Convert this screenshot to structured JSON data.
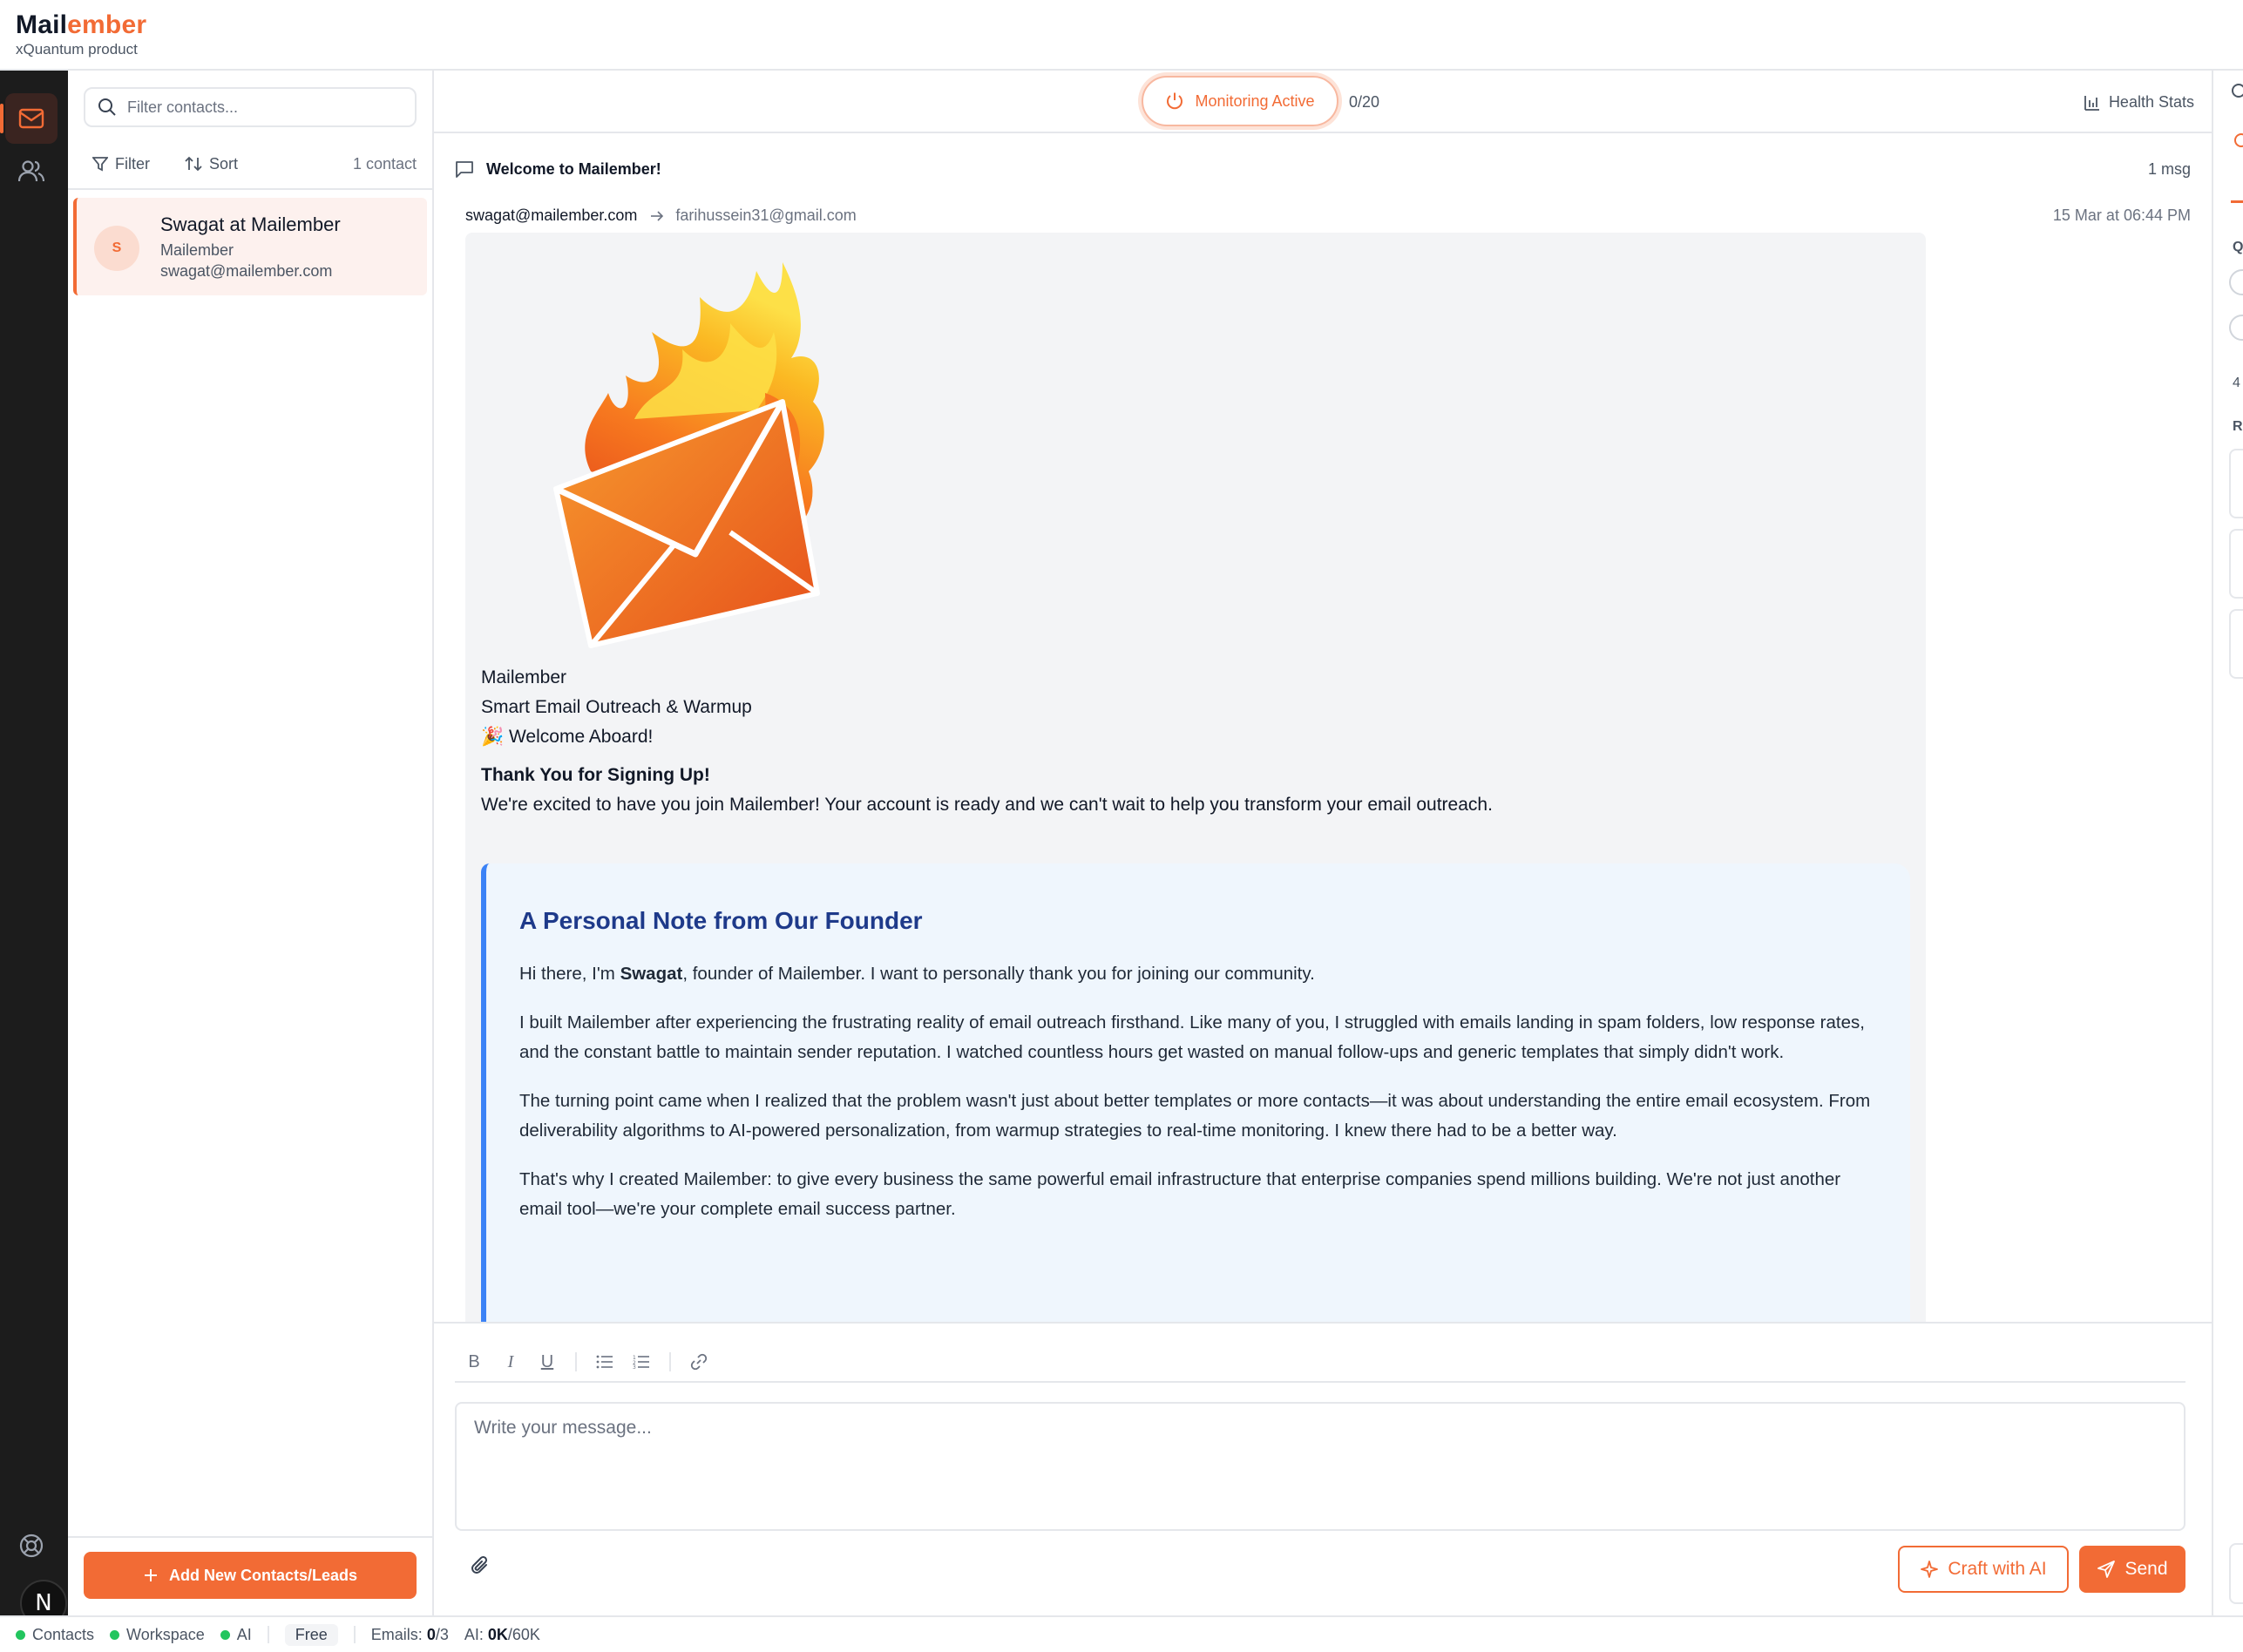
{
  "brand": {
    "name_part1": "Mail",
    "name_part2": "ember",
    "subtitle": "xQuantum product"
  },
  "colors": {
    "accent": "#f26b35",
    "rail": "#1c1c1c",
    "founder_bg": "#eff6fd",
    "founder_border": "#3b82f6",
    "status_dot": "#22c55e"
  },
  "rail": {
    "items": [
      {
        "icon": "mail-icon",
        "active": true
      },
      {
        "icon": "users-icon",
        "active": false
      }
    ],
    "bottom_icon": "help-lifebuoy-icon",
    "avatar_letter": "N"
  },
  "contacts": {
    "search_placeholder": "Filter contacts...",
    "filter_label": "Filter",
    "sort_label": "Sort",
    "count_label": "1 contact",
    "list": [
      {
        "initial": "S",
        "name": "Swagat at Mailember",
        "company": "Mailember",
        "email": "swagat@mailember.com"
      }
    ],
    "add_button": "Add New Contacts/Leads"
  },
  "monitor": {
    "label": "Monitoring Active",
    "count": "0/20",
    "health_label": "Health Stats"
  },
  "thread": {
    "title": "Welcome to Mailember!",
    "msg_count": "1 msg",
    "from": "swagat@mailember.com",
    "to": "farihussein31@gmail.com",
    "date": "15 Mar at 06:44 PM"
  },
  "email": {
    "line1": "Mailember",
    "line2": "Smart Email Outreach & Warmup",
    "line3": "🎉 Welcome Aboard!",
    "heading": "Thank You for Signing Up!",
    "intro": "We're excited to have you join Mailember! Your account is ready and we can't wait to help you transform your email outreach.",
    "founder_title": "A Personal Note from Our Founder",
    "p1_prefix": "Hi there, I'm ",
    "p1_name": "Swagat",
    "p1_suffix": ", founder of Mailember. I want to personally thank you for joining our community.",
    "p2": "I built Mailember after experiencing the frustrating reality of email outreach firsthand. Like many of you, I struggled with emails landing in spam folders, low response rates, and the constant battle to maintain sender reputation. I watched countless hours get wasted on manual follow-ups and generic templates that simply didn't work.",
    "p3": "The turning point came when I realized that the problem wasn't just about better templates or more contacts—it was about understanding the entire email ecosystem. From deliverability algorithms to AI-powered personalization, from warmup strategies to real-time monitoring. I knew there had to be a better way.",
    "p4": "That's why I created Mailember: to give every business the same powerful email infrastructure that enterprise companies spend millions building. We're not just another email tool—we're your complete email success partner."
  },
  "compose": {
    "placeholder": "Write your message...",
    "craft_label": "Craft with AI",
    "send_label": "Send"
  },
  "right_panel": {
    "letter1": "Q",
    "number": "4",
    "letter2": "R"
  },
  "statusbar": {
    "contacts": "Contacts",
    "workspace": "Workspace",
    "ai": "AI",
    "plan": "Free",
    "emails_label": "Emails:",
    "emails_used": "0",
    "emails_total": "/3",
    "ai_label": "AI:",
    "ai_used": "0K",
    "ai_total": "/60K"
  }
}
